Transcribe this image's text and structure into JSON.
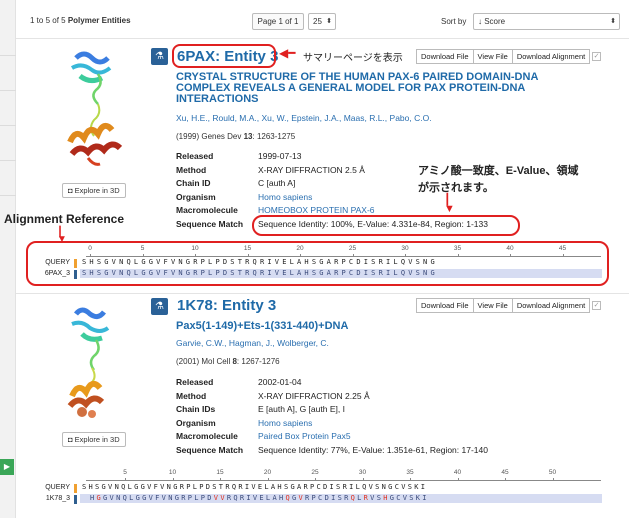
{
  "header": {
    "count_prefix": "1 to 5 of 5",
    "count_bold": "Polymer Entities",
    "page_select": "Page 1 of 1",
    "per_page": "25",
    "sort_label": "Sort by",
    "sort_value": "↓ Score"
  },
  "entries": [
    {
      "title": "6PAX: Entity 3",
      "buttons": [
        "Download File",
        "View File",
        "Download Alignment"
      ],
      "paper_title": "CRYSTAL STRUCTURE OF THE HUMAN PAX-6 PAIRED DOMAIN-DNA COMPLEX REVEALS A GENERAL MODEL FOR PAX PROTEIN-DNA INTERACTIONS",
      "authors": "Xu, H.E., Rould, M.A., Xu, W., Epstein, J.A., Maas, R.L., Pabo, C.O.",
      "cite_pre": "(1999) Genes Dev ",
      "cite_vol": "13",
      "cite_post": ": 1263-1275",
      "explore": "Explore in 3D",
      "fields": [
        {
          "k": "Released",
          "v": "1999-07-13"
        },
        {
          "k": "Method",
          "v": "X-RAY DIFFRACTION 2.5 Å"
        },
        {
          "k": "Chain ID",
          "v": "C [auth A]"
        },
        {
          "k": "Organism",
          "v": "Homo sapiens"
        },
        {
          "k": "Macromolecule",
          "v": "HOMEOBOX PROTEIN PAX-6"
        },
        {
          "k": "Sequence Match",
          "v": "Sequence Identity: 100%, E-Value: 4.331e-84, Region: 1-133"
        }
      ],
      "align_query_label": "QUERY",
      "align_target_label": "6PAX_3",
      "ticks": [
        "0",
        "5",
        "10",
        "15",
        "20",
        "25",
        "30",
        "35",
        "40",
        "45"
      ],
      "query_seq": "SHSGVNQLGGVFVNGRPLPDSTRQRIVELAHSGARPCDISRILQVSNG",
      "target_seq": "SHSGVNQLGGVFVNGRPLPDSTRQRIVELAHSGARPCDISRILQVSNG"
    },
    {
      "title": "1K78: Entity 3",
      "buttons": [
        "Download File",
        "View File",
        "Download Alignment"
      ],
      "paper_title": "Pax5(1-149)+Ets-1(331-440)+DNA",
      "authors": "Garvie, C.W., Hagman, J., Wolberger, C.",
      "cite_pre": "(2001) Mol Cell ",
      "cite_vol": "8",
      "cite_post": ": 1267-1276",
      "explore": "Explore in 3D",
      "fields": [
        {
          "k": "Released",
          "v": "2002-01-04"
        },
        {
          "k": "Method",
          "v": "X-RAY DIFFRACTION 2.25 Å"
        },
        {
          "k": "Chain IDs",
          "v": "E [auth A], G [auth E], I"
        },
        {
          "k": "Organism",
          "v": "Homo sapiens"
        },
        {
          "k": "Macromolecule",
          "v": "Paired Box Protein Pax5"
        },
        {
          "k": "Sequence Match",
          "v": "Sequence Identity: 77%, E-Value: 1.351e-61, Region: 17-140"
        }
      ],
      "align_query_label": "QUERY",
      "align_target_label": "1K78_3",
      "ticks": [
        "5",
        "10",
        "15",
        "20",
        "25",
        "30",
        "35",
        "40",
        "45",
        "50"
      ],
      "query_seq": "SHSGVNQLGGVFVNGRPLPDSTRQRIVELAHSGARPCDISRILQVSNGCVSKI",
      "target_seq": "HGGVNQLGGVFVNGRPLPDVVRQRIVELAHQGVRPCDISRQLRVSHGCVSKI"
    }
  ],
  "annotations": {
    "summary_note": "サマリーページを表示",
    "identity_note_1": "アミノ酸一致度、E-Value、領域",
    "identity_note_2": "が示されます。",
    "alignment_ref": "Alignment Reference"
  },
  "colors": {
    "link": "#1f6aa8",
    "annotation_red": "#e02020",
    "icon_blue": "#2a6197"
  }
}
